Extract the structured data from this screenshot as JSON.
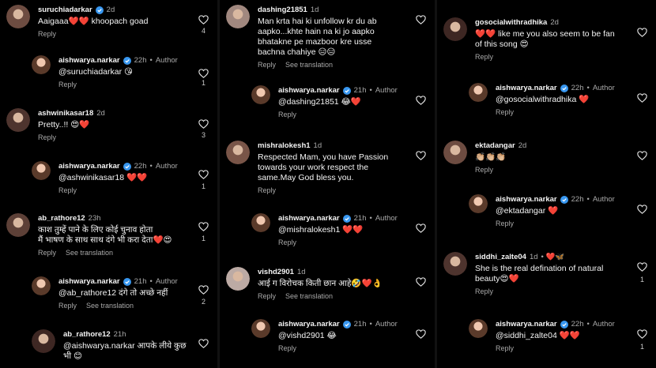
{
  "colors": {
    "verified": "#3897f0",
    "background": "#000000",
    "muted": "#a8a8a8"
  },
  "icons": {
    "like": "heart-outline-icon",
    "verified": "verified-badge-icon"
  },
  "labels": {
    "reply": "Reply",
    "see_translation": "See translation",
    "author": "Author"
  },
  "col1": [
    {
      "user": "suruchiadarkar",
      "time": "2d",
      "text": "Aaigaaa❤️❤️ khoopach goad",
      "likes": "4",
      "verified": true
    },
    {
      "user": "aishwarya.narkar",
      "time": "22h",
      "author": "Author",
      "text": "@suruchiadarkar 😘",
      "likes": "1",
      "verified": true
    },
    {
      "user": "ashwinikasar18",
      "time": "2d",
      "text": "Pretty..!! 😍❤️",
      "likes": "3"
    },
    {
      "user": "aishwarya.narkar",
      "time": "22h",
      "author": "Author",
      "text": "@ashwinikasar18 ❤️❤️",
      "likes": "1",
      "verified": true
    },
    {
      "user": "ab_rathore12",
      "time": "23h",
      "text": "काश तुम्हें पाने के लिए कोई चुनाव होता\nमैं भाषण के साथ साथ दंगे भी करा देता❤️😍",
      "likes": "1",
      "see_translation": true
    },
    {
      "user": "aishwarya.narkar",
      "time": "21h",
      "author": "Author",
      "text": "@ab_rathore12 दंगे तो अच्छे नहीं",
      "likes": "2",
      "verified": true,
      "see_translation": true
    },
    {
      "user": "ab_rathore12",
      "time": "21h",
      "text": "@aishwarya.narkar आपके लीये कुछ\nभी 😊",
      "likes": ""
    }
  ],
  "col2": [
    {
      "user": "dashing21851",
      "time": "1d",
      "text": "Man krta hai ki unfollow kr du ab\naapko...khte hain na ki jo aapko\nbhatakne pe mazboor kre usse\nbachna chahiye 😑😑",
      "likes": "",
      "see_translation": true
    },
    {
      "user": "aishwarya.narkar",
      "time": "21h",
      "author": "Author",
      "text": "@dashing21851 😂❤️",
      "likes": "",
      "verified": true
    },
    {
      "user": "mishralokesh1",
      "time": "1d",
      "text": "Respected Mam, you have Passion\ntowards your work respect the\nsame.May God bless you.",
      "likes": ""
    },
    {
      "user": "aishwarya.narkar",
      "time": "21h",
      "author": "Author",
      "text": "@mishralokesh1 ❤️❤️",
      "likes": "",
      "verified": true
    },
    {
      "user": "vishd2901",
      "time": "1d",
      "text": "आई ग विरोचक किती छान आहे🤣❤️👌",
      "likes": "",
      "see_translation": true
    },
    {
      "user": "aishwarya.narkar",
      "time": "21h",
      "author": "Author",
      "text": "@vishd2901 😂",
      "likes": "",
      "verified": true
    }
  ],
  "col3": [
    {
      "user": "gosocialwithradhika",
      "time": "2d",
      "text": "❤️❤️ like me you also seem to be fan\nof this song 😍",
      "likes": ""
    },
    {
      "user": "aishwarya.narkar",
      "time": "22h",
      "author": "Author",
      "text": "@gosocialwithradhika ❤️",
      "likes": "",
      "verified": true
    },
    {
      "user": "ektadangar",
      "time": "2d",
      "text": "👏🏼👏🏼👏🏼",
      "likes": ""
    },
    {
      "user": "aishwarya.narkar",
      "time": "22h",
      "author": "Author",
      "text": "@ektadangar ❤️",
      "likes": "",
      "verified": true
    },
    {
      "user": "siddhi_zalte04",
      "time": "1d",
      "extra": "• ❤️🦋",
      "text": "She is the real defination of natural\nbeauty😍❤️",
      "likes": "1"
    },
    {
      "user": "aishwarya.narkar",
      "time": "22h",
      "author": "Author",
      "text": "@siddhi_zalte04 ❤️❤️",
      "likes": "1",
      "verified": true
    }
  ]
}
